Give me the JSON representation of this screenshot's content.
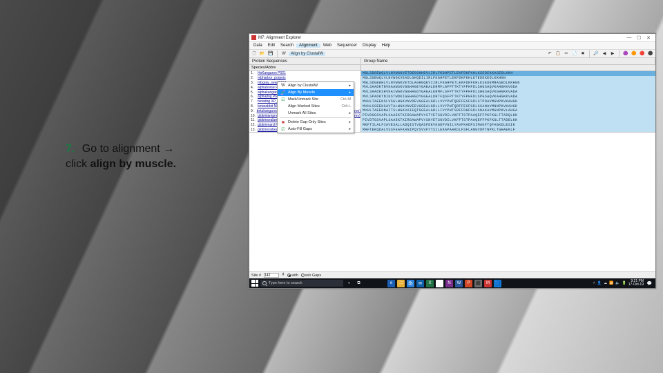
{
  "instruction": {
    "number": "7.",
    "line1_plain": "Go to alignment →",
    "line2_prefix": "click ",
    "line2_bold": "align by muscle."
  },
  "app": {
    "title": "M7: Alignment Explorer",
    "menus": [
      "Data",
      "Edit",
      "Search",
      "Alignment",
      "Web",
      "Sequencer",
      "Display",
      "Help"
    ],
    "active_menu_index": 3,
    "toolbar_labels": {
      "clustal": "Align by ClustalW"
    },
    "panel_left": "Protein Sequences",
    "panel_right": "Group Name",
    "names_header": "Species/Abbrv",
    "dropdown": {
      "items": [
        {
          "ico": "W",
          "label": "Align by ClustalW"
        },
        {
          "ico": "🧬",
          "label": "Align By Muscle",
          "highlight": true
        },
        {
          "ico": "☑",
          "ico_color": "#2a9d4a",
          "label": "Mark/Unmark Site",
          "key": "Ctrl+M"
        },
        {
          "label": "Align Marked Sites",
          "key": "Ctrl+L"
        },
        {
          "label": "Unmark All Sites"
        },
        {
          "sep": true
        },
        {
          "ico": "✖",
          "ico_color": "#c33",
          "label": "Delete Gap-Only Sites"
        },
        {
          "ico": "☑",
          "ico_color": "#2a9d4a",
          "label": "Auto-Fill Gaps"
        }
      ]
    },
    "rows": [
      {
        "n": "1.",
        "name": "HsKangaroo P021"
      },
      {
        "n": "2.",
        "name": "mbharbor_porpois"
      },
      {
        "n": "3.",
        "name": "mbgray_seal P684"
      },
      {
        "n": "4.",
        "name": "alphahorse P0170"
      },
      {
        "n": "5.",
        "name": "alphakangaroo P0",
        "tail": " (eastern gray kangaroo)"
      },
      {
        "n": "6.",
        "name": "alphadog P60529 Canis lupus familiaris (dog)"
      },
      {
        "n": "7.",
        "name": "betadog XP_537902 Canis lupus familiaris (dog)"
      },
      {
        "n": "8.",
        "name": "betarabbit NP_001075729 Oryctolagus cuniculus (rabbit)"
      },
      {
        "n": "9.",
        "name": "betakangaroo P02106 Macropus giganteus (eastern gray kangaroo)"
      },
      {
        "n": "10.",
        "name": "globinlamprey 599514 Lampetra fluviatilis (European river lamprey)"
      },
      {
        "n": "11.",
        "name": "globinsealamprey P02208 Petromyzon marinus (sea lamprey)"
      },
      {
        "n": "12.",
        "name": "globinmard P02229 Chironomus thummi thummi (midge)"
      },
      {
        "n": "13.",
        "name": "globinsoybean 7116744 Glycine max (soybean)"
      }
    ],
    "seq_lines": [
      "MGLSDGEWQLVLNVWGKVETDEGGHHDVLIRLFKDHPETLEKFDKFKHLKSEDEKKASEDLKKH",
      "MGLSGEWQLVLNVWGKVEADLGHQDILIRLFKGHPETLEKFDKFKHLKTEDEKEDLKKHGN",
      "MGLSDGEWHLVLNVWGKVETDLAGHGQEVIIRLFKGHPETLEKFDKFKHLKSEDEMRASEDLKKHGN",
      "MVLSAADKTNVKAAWSKVGGHAGEYGAEALERMFLGFPTTKTYFPHFDLSHGSAQVKAHGKKVGDA",
      "MVLSAADKSHVKAIWGKVGGHAGDYGAEALERMFLSFPTTKTYFPHFDLSHGSAQVKGHGKKVADA",
      "MVLSPADKTNIKSTWDKIGGHAGDYGGEALDRTFQSFPTTKTYFPHFDLSPGSAQVKAHGKKVADA",
      "MVHLTAEEKSLVSGLWGKVNVDEVGGEALGRLLVVYPWTQRFFESFGDLSTPDAVMGNPKVKAHGK",
      "MVHLSSEEKSAVTALWGKVNVEEVGGEALGRLLVVYPWTQRFFESFGDLSSANAVMNNPKVKAHGK",
      "MVHLTAEEKNAITSLWGKVAIEQTGGEALGRLLIVYPWTSRFFDHFGDLSNAKAVMGNPKVLAHGA",
      "PIVDSGSVAPLSAAEKTKIRSAWAPVYSTYETSGVDILVKFFTSTPAAQEFFPKFKGLTTADQLKK",
      "PIVDTGSVAPLSAAEKTKIRSAWAPVYSNYETSGVDILVKFFTSTPAAQEFFPKFKGLTTADELKK",
      "MKFTILALFIAVESALLADQISTVQASFDKVKGDPVGILYAVFKADPSIMAKFTQFAGKDLESIK",
      "MAFTEKQDALVSSFEAFKANIPQYSVVFYTSILEKAPAAKDLFSFLANGVDPTNPKLTGHAEKLF"
    ]
  },
  "statusbar": {
    "label": "Site #",
    "value": "142",
    "with": "with",
    "wo": "w/o Gaps"
  },
  "taskbar": {
    "search_placeholder": "Type here to search",
    "clock_time": "9:21 PM",
    "clock_date": "17-Oct-19"
  },
  "colors": {
    "accent": "#1e90ff",
    "menu_hl": "#cde6f7",
    "seq_bg": "#bfe0f2"
  }
}
